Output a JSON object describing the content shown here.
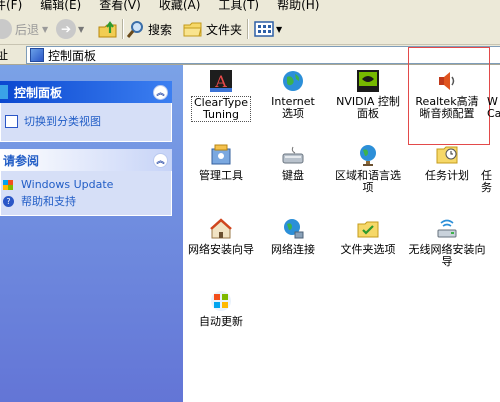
{
  "menu": [
    "件(F)",
    "编辑(E)",
    "查看(V)",
    "收藏(A)",
    "工具(T)",
    "帮助(H)"
  ],
  "toolbar": {
    "back": "后退",
    "search": "搜索",
    "folders": "文件夹"
  },
  "address": {
    "text": "控制面板"
  },
  "left_pane": {
    "control_panel_title": "控制面板",
    "switch_view": "切换到分类视图",
    "see_also_title": "请参阅",
    "windows_update": "Windows Update",
    "help_support": "帮助和支持"
  },
  "items": [
    {
      "label": "ClearType Tuning",
      "icon": "cleartype-icon"
    },
    {
      "label": "Internet 选项",
      "icon": "globe-icon"
    },
    {
      "label": "NVIDIA 控制面板",
      "icon": "nvidia-icon"
    },
    {
      "label": "Realtek高清晰音频配置",
      "icon": "speaker-icon"
    },
    {
      "label": "W Ca",
      "icon": "partial-icon"
    },
    {
      "label": "管理工具",
      "icon": "admin-tools-icon"
    },
    {
      "label": "键盘",
      "icon": "keyboard-icon"
    },
    {
      "label": "区域和语言选项",
      "icon": "globe-regional-icon"
    },
    {
      "label": "任务计划",
      "icon": "scheduled-tasks-icon"
    },
    {
      "label": "任务",
      "icon": "partial-icon"
    },
    {
      "label": "网络安装向导",
      "icon": "network-setup-icon"
    },
    {
      "label": "网络连接",
      "icon": "network-connections-icon"
    },
    {
      "label": "文件夹选项",
      "icon": "folder-options-icon"
    },
    {
      "label": "无线网络安装向导",
      "icon": "wireless-setup-icon"
    },
    {
      "label": "自动更新",
      "icon": "windows-update-icon"
    }
  ]
}
